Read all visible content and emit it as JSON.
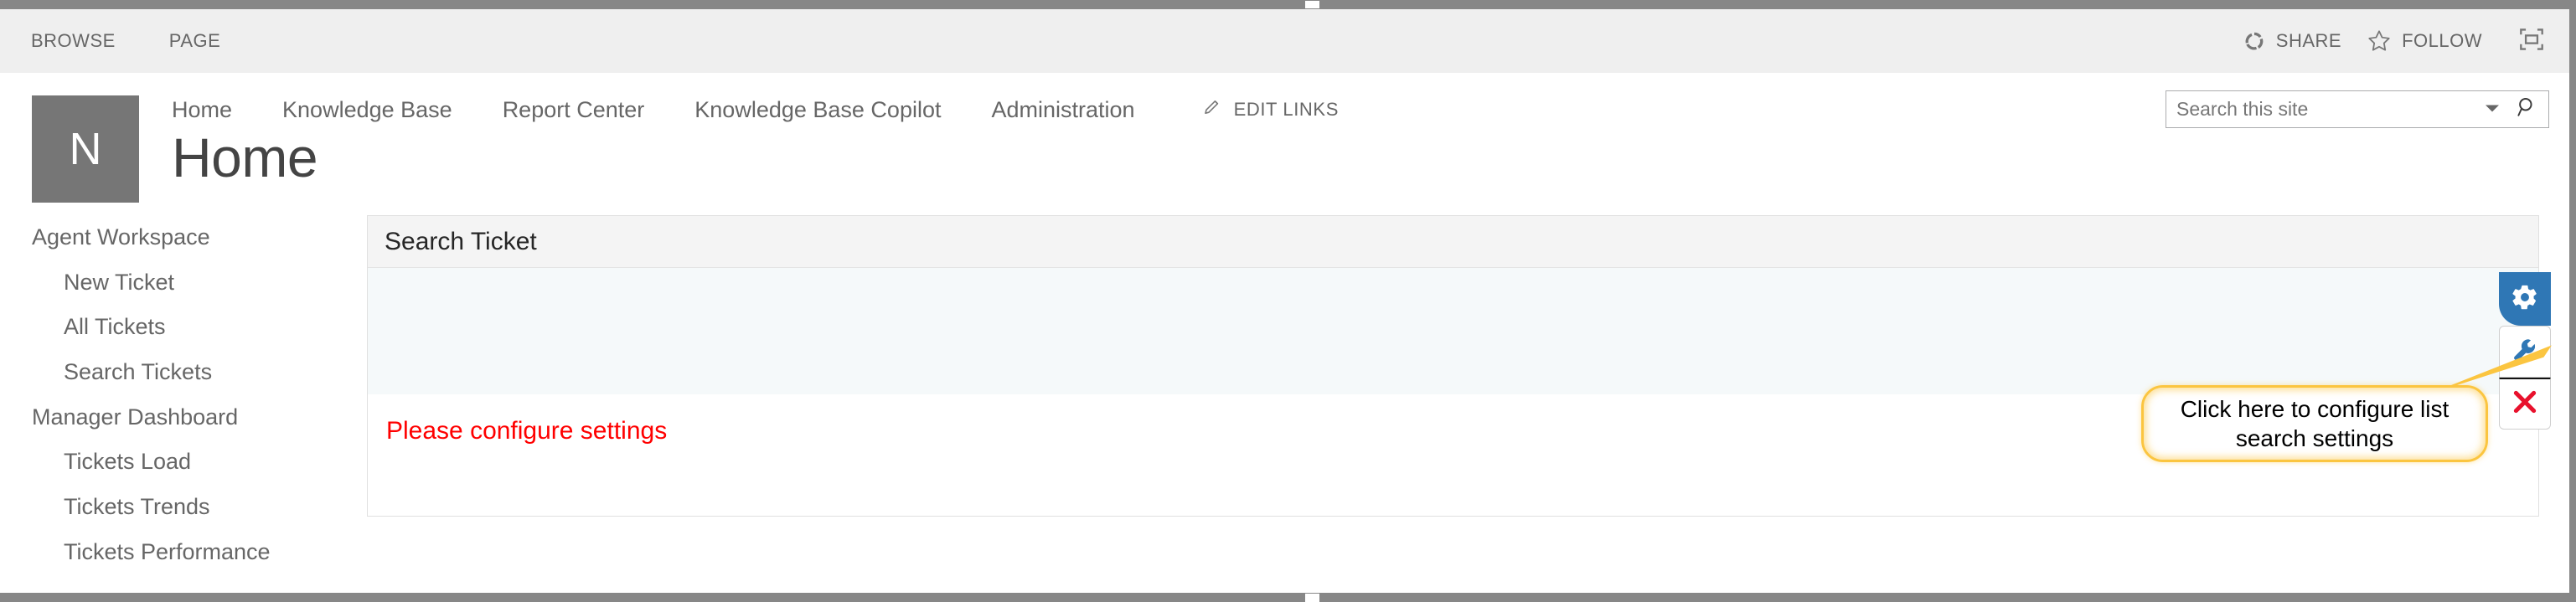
{
  "window": {
    "grip_icon": "resize-grip"
  },
  "suitebar": {
    "ribbon_tabs": [
      {
        "label": "BROWSE",
        "name": "ribbon-tab-browse"
      },
      {
        "label": "PAGE",
        "name": "ribbon-tab-page"
      }
    ],
    "share": {
      "label": "SHARE",
      "icon": "share-icon"
    },
    "follow": {
      "label": "FOLLOW",
      "icon": "star-icon"
    },
    "focus": {
      "icon": "focus-on-content-icon"
    }
  },
  "site": {
    "logo_letter": "N",
    "page_title": "Home",
    "nav": [
      {
        "label": "Home"
      },
      {
        "label": "Knowledge Base"
      },
      {
        "label": "Report Center"
      },
      {
        "label": "Knowledge Base Copilot"
      },
      {
        "label": "Administration"
      }
    ],
    "edit_links": {
      "label": "EDIT LINKS",
      "icon": "pencil-icon"
    }
  },
  "search": {
    "placeholder": "Search this site",
    "value": "",
    "chevron_icon": "chevron-down-icon",
    "go_icon": "search-icon"
  },
  "sidebar": {
    "groups": [
      {
        "heading": "Agent Workspace",
        "items": [
          {
            "label": "New Ticket"
          },
          {
            "label": "All Tickets"
          },
          {
            "label": "Search Tickets"
          }
        ]
      },
      {
        "heading": "Manager Dashboard",
        "items": [
          {
            "label": "Tickets Load"
          },
          {
            "label": "Tickets Trends"
          },
          {
            "label": "Tickets Performance"
          }
        ]
      }
    ]
  },
  "webpart": {
    "title": "Search Ticket",
    "message": "Please configure settings",
    "message_color": "#ff0000"
  },
  "actions": {
    "gear": {
      "icon": "gear-icon",
      "tooltip": "Settings",
      "bg": "#2f77b5"
    },
    "wrench": {
      "icon": "wrench-icon",
      "color": "#2f77b5"
    },
    "close": {
      "icon": "close-x-icon",
      "color": "#e8112d"
    }
  },
  "callout": {
    "text": "Click here to configure list search settings",
    "border_color": "#fbc540"
  }
}
